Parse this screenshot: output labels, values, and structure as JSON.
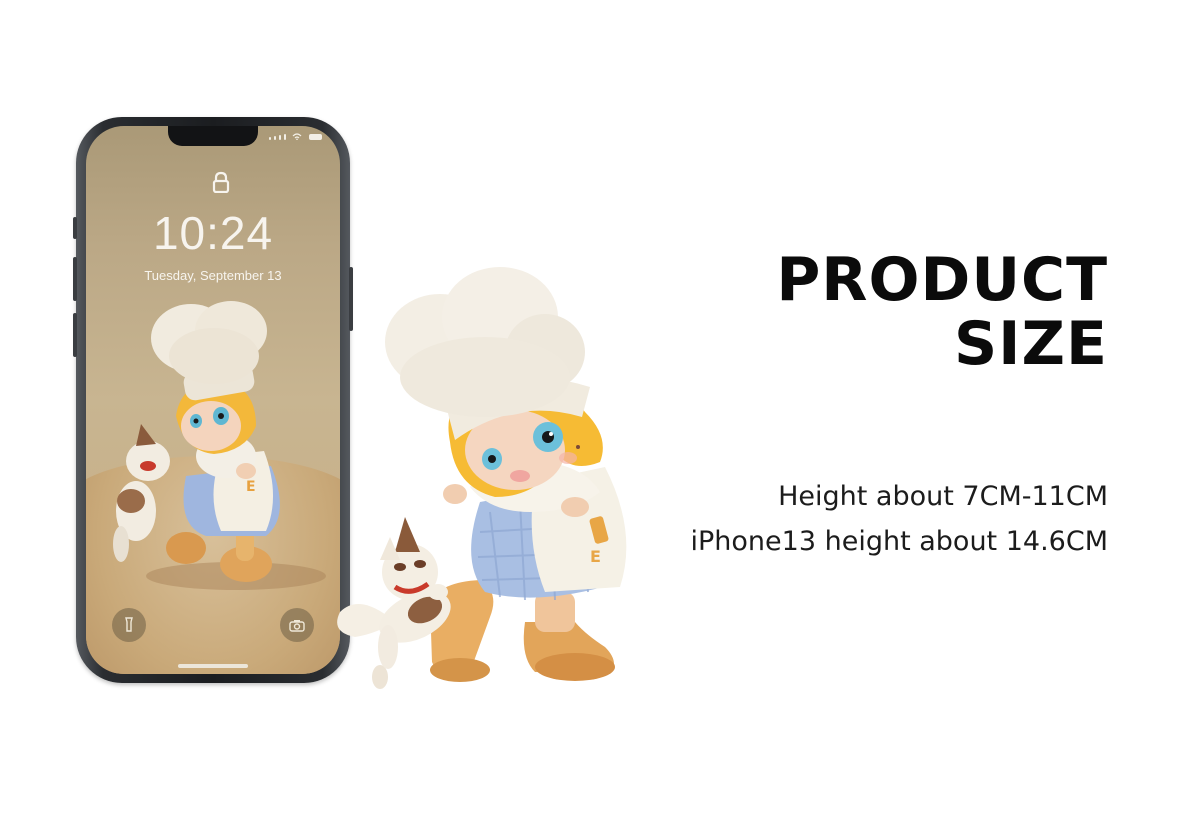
{
  "heading": {
    "line1": "PRODUCT",
    "line2": "SIZE"
  },
  "description": {
    "line1": "Height about 7CM-11CM",
    "line2": "iPhone13 height about 14.6CM"
  },
  "phone": {
    "time": "10:24",
    "date": "Tuesday, September 13",
    "icons": [
      "lock-icon",
      "flashlight-icon",
      "camera-icon",
      "signal-icon",
      "wifi-icon",
      "battery-icon"
    ]
  },
  "colors": {
    "background": "#ffffff",
    "heading": "#0b0b0b",
    "body_text": "#1c1c1c",
    "phone_frame": "#1b1d20",
    "chef_hat": "#efe9dd",
    "hair": "#f3b93a",
    "dress_plaid": "#a9bfe3",
    "apron": "#f5f1e6",
    "boots": "#e2a55a"
  }
}
